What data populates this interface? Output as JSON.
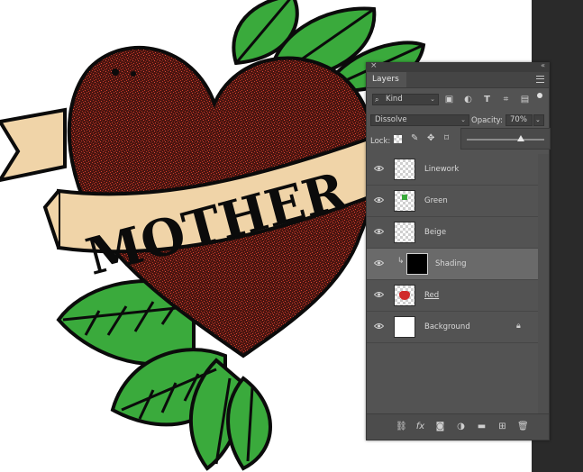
{
  "artwork": {
    "banner_text": "MOTHER",
    "colors": {
      "heart": "#4a1510",
      "leaf": "#3aaa3c",
      "banner": "#f0d4a8",
      "outline": "#0b0b0b"
    }
  },
  "panel": {
    "title": "Layers",
    "filter_kind": "Kind",
    "blend_mode": "Dissolve",
    "opacity_label": "Opacity:",
    "opacity_value": "70%",
    "opacity_fraction": 0.7,
    "lock_label": "Lock:",
    "layers": [
      {
        "name": "Linework",
        "visible": true,
        "selected": false
      },
      {
        "name": "Green",
        "visible": true,
        "selected": false
      },
      {
        "name": "Beige",
        "visible": true,
        "selected": false
      },
      {
        "name": "Shading",
        "visible": true,
        "selected": true,
        "clipped": true
      },
      {
        "name": "Red",
        "visible": true,
        "selected": false
      },
      {
        "name": "Background",
        "visible": true,
        "selected": false,
        "locked": true
      }
    ],
    "bottom_icons": [
      "link-icon",
      "fx-icon",
      "mask-icon",
      "adjustment-icon",
      "folder-icon",
      "new-layer-icon",
      "trash-icon"
    ]
  }
}
